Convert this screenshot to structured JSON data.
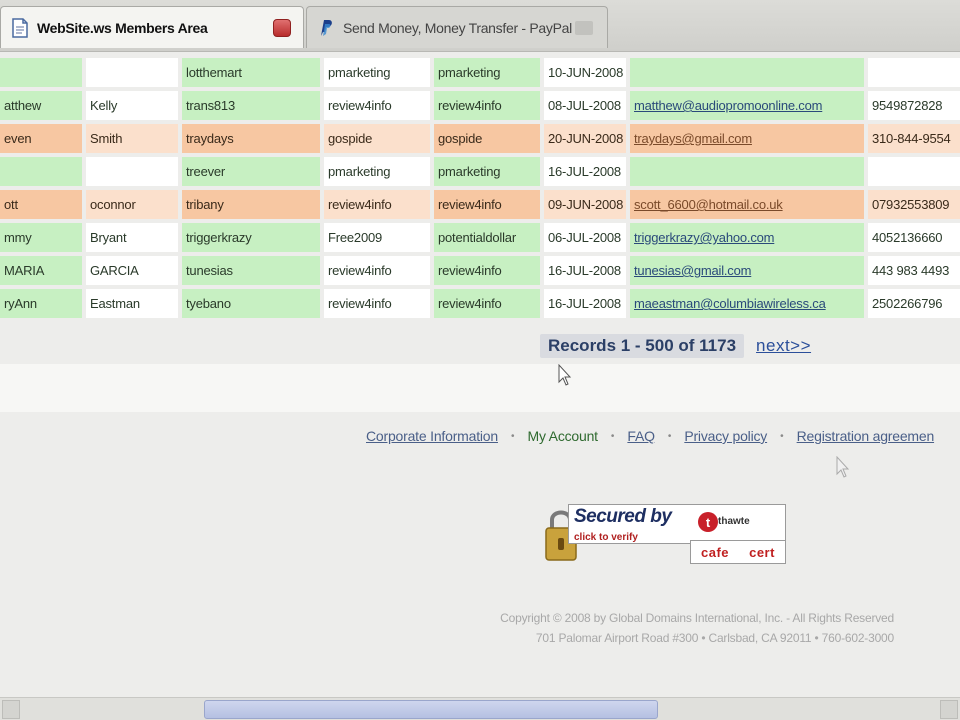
{
  "tabs": [
    {
      "label": "WebSite.ws Members Area",
      "active": true
    },
    {
      "label": "Send Money, Money Transfer - PayPal",
      "active": false
    }
  ],
  "table": {
    "rows": [
      {
        "style": "green",
        "first": "",
        "last": "",
        "username": "lotthemart",
        "plan": "pmarketing",
        "sponsor": "pmarketing",
        "date": "10-JUN-2008",
        "email": "",
        "phone": ""
      },
      {
        "style": "green",
        "first": "atthew",
        "last": "Kelly",
        "username": "trans813",
        "plan": "review4info",
        "sponsor": "review4info",
        "date": "08-JUL-2008",
        "email": "matthew@audiopromoonline.com",
        "phone": "9549872828"
      },
      {
        "style": "orange",
        "first": "even",
        "last": "Smith",
        "username": "traydays",
        "plan": "gospide",
        "sponsor": "gospide",
        "date": "20-JUN-2008",
        "email": "traydays@gmail.com",
        "phone": "310-844-9554"
      },
      {
        "style": "green",
        "first": "",
        "last": "",
        "username": "treever",
        "plan": "pmarketing",
        "sponsor": "pmarketing",
        "date": "16-JUL-2008",
        "email": "",
        "phone": ""
      },
      {
        "style": "orange",
        "first": "ott",
        "last": "oconnor",
        "username": "tribany",
        "plan": "review4info",
        "sponsor": "review4info",
        "date": "09-JUN-2008",
        "email": "scott_6600@hotmail.co.uk",
        "phone": "07932553809"
      },
      {
        "style": "green",
        "first": "mmy",
        "last": "Bryant",
        "username": "triggerkrazy",
        "plan": "Free2009",
        "sponsor": "potentialdollar",
        "date": "06-JUL-2008",
        "email": "triggerkrazy@yahoo.com",
        "phone": "4052136660"
      },
      {
        "style": "green",
        "first": "MARIA",
        "last": "GARCIA",
        "username": "tunesias",
        "plan": "review4info",
        "sponsor": "review4info",
        "date": "16-JUL-2008",
        "email": "tunesias@gmail.com",
        "phone": "443 983 4493"
      },
      {
        "style": "green",
        "first": "ryAnn",
        "last": "Eastman",
        "username": "tyebano",
        "plan": "review4info",
        "sponsor": "review4info",
        "date": "16-JUL-2008",
        "email": "maeastman@columbiawireless.ca",
        "phone": "2502266796"
      }
    ]
  },
  "pager": {
    "records_label": "Records 1 - 500 of 1173",
    "next_label": "next>>"
  },
  "footer": {
    "links": [
      {
        "label": "Corporate Information",
        "current": false
      },
      {
        "label": "My Account",
        "current": true
      },
      {
        "label": "FAQ",
        "current": false
      },
      {
        "label": "Privacy policy",
        "current": false
      },
      {
        "label": "Registration agreemen",
        "current": false
      }
    ],
    "separator": "•"
  },
  "seal": {
    "title": "Secured by",
    "sub": "click to verify",
    "brand": "thawte",
    "bottom_left": "cafe",
    "bottom_right": "cert"
  },
  "copyright": {
    "line1": "Copyright © 2008 by Global Domains International, Inc. - All Rights Reserved",
    "line2": "701 Palomar Airport Road #300 • Carlsbad, CA 92011 • 760-602-3000"
  },
  "colors": {
    "row_green": "#c7f0c2",
    "row_orange": "#f7c7a2",
    "link": "#4a5f88"
  }
}
